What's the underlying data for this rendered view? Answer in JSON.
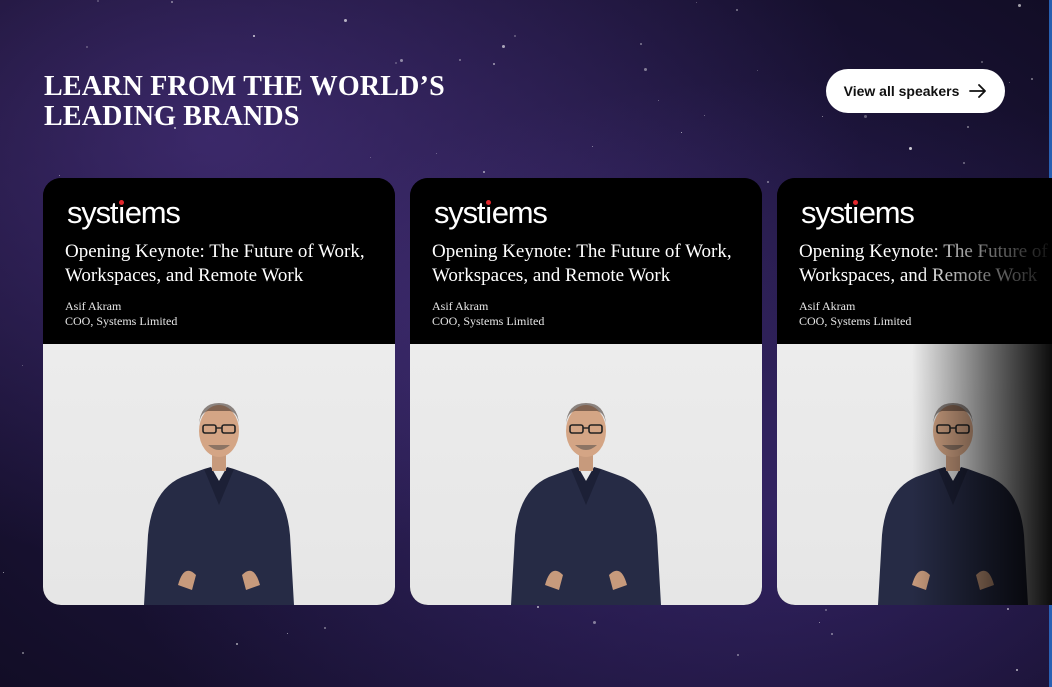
{
  "header": {
    "title_line1": "LEARN FROM THE WORLD’S",
    "title_line2": "LEADING BRANDS",
    "view_all_label": "View all speakers"
  },
  "icons": {
    "arrow": "arrow-right-icon"
  },
  "colors": {
    "background": "#1a1336",
    "card_top": "#000000",
    "photo_bg": "#e9e9e9",
    "button_bg": "#ffffff",
    "logo_dot": "#e3262b"
  },
  "speakers": [
    {
      "logo_pre": "syst",
      "logo_i": "ı",
      "logo_post": "ems",
      "talk_title": "Opening Keynote: The Future of Work, Workspaces, and Remote Work",
      "name": "Asif Akram",
      "role": "COO, Systems Limited"
    },
    {
      "logo_pre": "syst",
      "logo_i": "ı",
      "logo_post": "ems",
      "talk_title": "Opening Keynote: The Future of Work, Workspaces, and Remote Work",
      "name": "Asif Akram",
      "role": "COO, Systems Limited"
    },
    {
      "logo_pre": "syst",
      "logo_i": "ı",
      "logo_post": "ems",
      "talk_title": "Opening Keynote: The Future of Work, Workspaces, and Remote Work",
      "name": "Asif Akram",
      "role": "COO, Systems Limited"
    }
  ]
}
